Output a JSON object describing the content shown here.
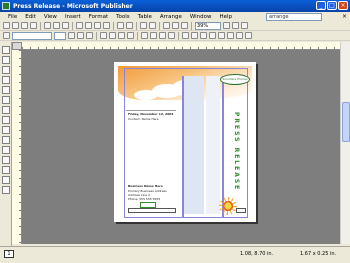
{
  "window": {
    "title": "Press Release - Microsoft Publisher",
    "controls": [
      "_",
      "□",
      "×"
    ]
  },
  "menubar": {
    "items": [
      "File",
      "Edit",
      "View",
      "Insert",
      "Format",
      "Tools",
      "Table",
      "Arrange",
      "Window",
      "Help"
    ],
    "help_box": "arrange"
  },
  "toolbar": {
    "zoom": "39%"
  },
  "page": {
    "logo_text": "Sunshine Homes",
    "vertical_title": "PRESS RELEASE",
    "date_line": "Friday, November 12, 2004",
    "sub_line": "Contact: Name Here",
    "body_heading": "Business Name Here",
    "body_line1": "Primary Business Address",
    "body_line2": "Address Line 2",
    "body_line3": "Phone: 555 555 5555"
  },
  "status": {
    "page_number": "1",
    "position": "1.08, 8.70 in.",
    "size": "1.67 x 0.25 in."
  },
  "colors": {
    "title_bar": "#0a5fd8",
    "workspace": "#7e7e7e",
    "accent_green": "#2f8f2f",
    "sky_orange": "#f39a3a"
  }
}
